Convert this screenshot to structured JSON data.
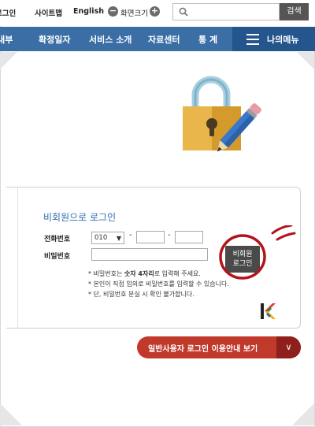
{
  "topbar": {
    "login": "로그인",
    "sitemap": "사이트맵",
    "english": "English",
    "zoom_label": "화면크기",
    "zoom_out": "−",
    "zoom_in": "+",
    "search_placeholder": "",
    "search_button": "검색"
  },
  "nav": {
    "items": [
      "안내부",
      "확정일자",
      "서비스 소개",
      "자료센터",
      "통 계"
    ],
    "my_menu": "나의메뉴"
  },
  "login_panel": {
    "title": "비회원으로 로그인",
    "phone_label": "전화번호",
    "phone_prefix": "010",
    "phone_sep1": "-",
    "phone_sep2": "-",
    "password_label": "비밀번호",
    "button_line1": "비회원",
    "button_line2": "로그인",
    "notes": [
      {
        "pre": "* 비밀번호는 ",
        "bold": "숫자 4자리",
        "post": "로 입력해 주세요."
      },
      {
        "pre": "* 본인이 직접 임의로 비밀번호를 입력할 수 있습니다.",
        "bold": "",
        "post": ""
      },
      {
        "pre": "* 단, 비밀번호 분실 시 확인 불가합니다.",
        "bold": "",
        "post": ""
      }
    ]
  },
  "guide_button": {
    "label": "일반사용자 로그인 이용안내 보기",
    "arrow": "∨"
  },
  "colors": {
    "nav_bg": "#3a6ea5",
    "my_menu_bg": "#24558c",
    "title_blue": "#2f6bb0",
    "guide_red": "#c0392b",
    "highlight_circle": "#b3141b"
  },
  "icons": [
    "search-icon",
    "zoom-out-icon",
    "zoom-in-icon",
    "hamburger-icon",
    "lock-pencil-illustration",
    "chevron-down-icon",
    "kr-logo-icon"
  ]
}
